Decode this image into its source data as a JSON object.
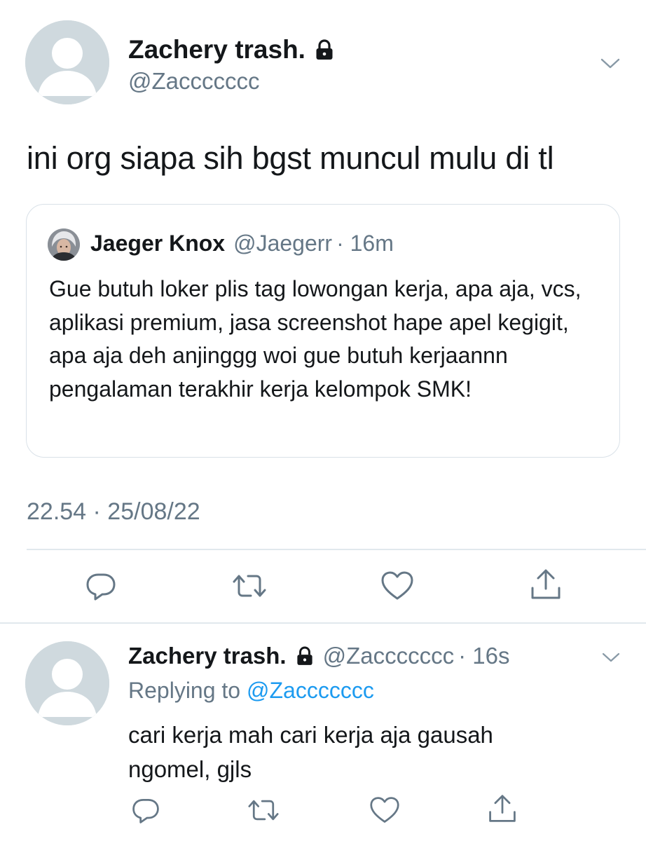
{
  "main_tweet": {
    "display_name": "Zachery trash.",
    "handle": "@Zaccccccc",
    "text": "ini org siapa sih bgst muncul mulu di tl",
    "timestamp": "22.54 · 25/08/22",
    "icons": {
      "protected": "lock-icon",
      "more": "chevron-down-icon"
    }
  },
  "quoted_tweet": {
    "display_name": "Jaeger Knox",
    "handle": "@Jaegerr",
    "time": "· 16m",
    "text": "Gue butuh loker plis tag lowongan kerja, apa aja, vcs, aplikasi premium, jasa screenshot hape apel kegigit, apa aja deh anjinggg woi gue butuh kerjaannn pengalaman terakhir kerja kelompok SMK!"
  },
  "main_actions": [
    "reply-icon",
    "retweet-icon",
    "like-icon",
    "share-icon"
  ],
  "reply_tweet": {
    "display_name": "Zachery trash.",
    "handle": "@Zaccccccc",
    "time": "· 16s",
    "replying_label": "Replying to",
    "replying_to": "@Zaccccccc",
    "text": "cari kerja mah cari kerja aja gausah ngomel, gjls",
    "icons": {
      "protected": "lock-icon",
      "more": "chevron-down-icon"
    }
  },
  "reply_actions": [
    "reply-icon",
    "retweet-icon",
    "like-icon",
    "share-icon"
  ],
  "colors": {
    "text": "#14171a",
    "muted": "#657786",
    "link": "#1d9bf0",
    "border": "#d9e1e8",
    "avatar_bg": "#cfd9de"
  }
}
